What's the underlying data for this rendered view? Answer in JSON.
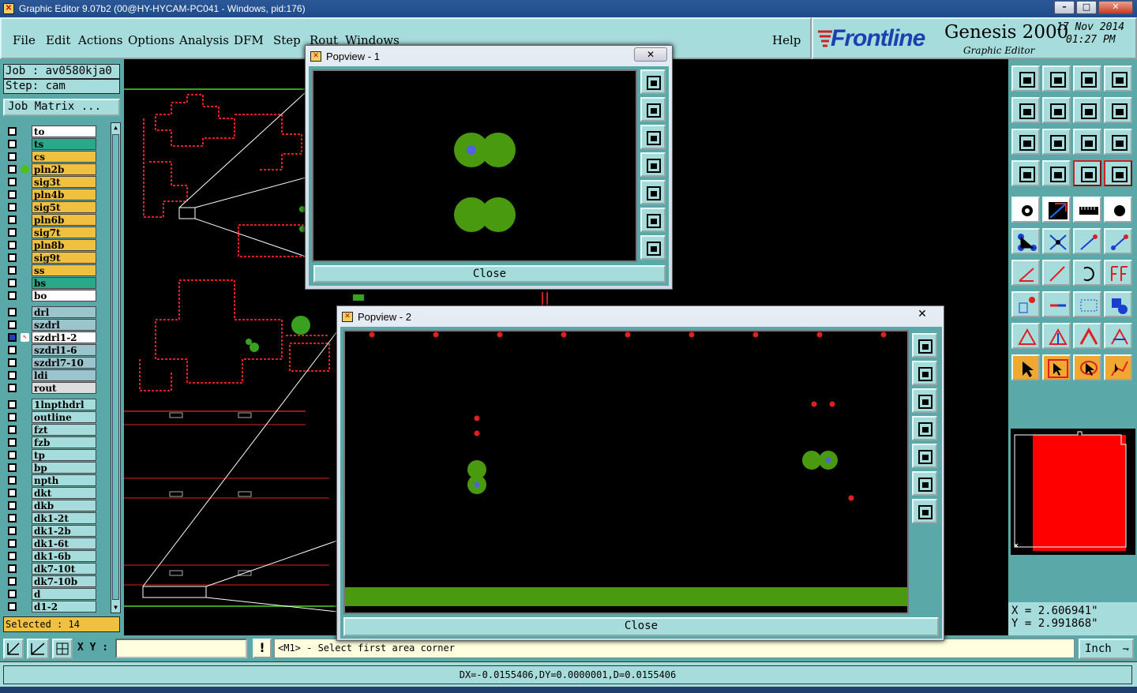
{
  "window": {
    "title": "Graphic Editor 9.07b2 (00@HY-HYCAM-PC041 - Windows, pid:176)"
  },
  "menu": {
    "items": [
      "File",
      "Edit",
      "Actions",
      "Options",
      "Analysis",
      "DFM",
      "Step",
      "Rout",
      "Windows"
    ],
    "help": "Help"
  },
  "brand": {
    "logo": "Frontline",
    "product": "Genesis 2000",
    "subtitle": "Graphic Editor",
    "date": "17 Nov 2014",
    "time": "01:27 PM"
  },
  "job": {
    "job_label": "Job : av0580kja0",
    "step_label": "Step: cam",
    "matrix_button": "Job Matrix ..."
  },
  "layers": {
    "board": [
      {
        "name": "to",
        "color": "#ffffff"
      },
      {
        "name": "ts",
        "color": "#2aa88a"
      },
      {
        "name": "cs",
        "color": "#f0c040"
      },
      {
        "name": "pln2b",
        "color": "#f0c040",
        "marker": "#4cc020"
      },
      {
        "name": "sig3t",
        "color": "#f0c040"
      },
      {
        "name": "pln4b",
        "color": "#f0c040"
      },
      {
        "name": "sig5t",
        "color": "#f0c040"
      },
      {
        "name": "pln6b",
        "color": "#f0c040"
      },
      {
        "name": "sig7t",
        "color": "#f0c040"
      },
      {
        "name": "pln8b",
        "color": "#f0c040"
      },
      {
        "name": "sig9t",
        "color": "#f0c040"
      },
      {
        "name": "ss",
        "color": "#f0c040"
      },
      {
        "name": "bs",
        "color": "#2aa88a"
      },
      {
        "name": "bo",
        "color": "#ffffff"
      }
    ],
    "drill": [
      {
        "name": "drl",
        "color": "#9cc4cc"
      },
      {
        "name": "szdrl",
        "color": "#9cc4cc"
      },
      {
        "name": "szdrl1-2",
        "color": "#ffffff",
        "active": true
      },
      {
        "name": "szdrl1-6",
        "color": "#9cc4cc"
      },
      {
        "name": "szdrl7-10",
        "color": "#9cc4cc"
      },
      {
        "name": "ldi",
        "color": "#9cc4cc"
      },
      {
        "name": "rout",
        "color": "#dddddd"
      }
    ],
    "misc": [
      {
        "name": "1lnpthdrl"
      },
      {
        "name": "outline"
      },
      {
        "name": "fzt"
      },
      {
        "name": "fzb"
      },
      {
        "name": "tp"
      },
      {
        "name": "bp"
      },
      {
        "name": "npth"
      },
      {
        "name": "dkt"
      },
      {
        "name": "dkb"
      },
      {
        "name": "dk1-2t"
      },
      {
        "name": "dk1-2b"
      },
      {
        "name": "dk1-6t"
      },
      {
        "name": "dk1-6b"
      },
      {
        "name": "dk7-10t"
      },
      {
        "name": "dk7-10b"
      },
      {
        "name": "d"
      },
      {
        "name": "d1-2"
      }
    ],
    "selected_label": "Selected : 14"
  },
  "popup1": {
    "title": "Popview - 1",
    "close_label": "Close"
  },
  "popup2": {
    "title": "Popview - 2",
    "close_label": "Close"
  },
  "coords": {
    "x": "X = 2.606941\"",
    "y": "Y = 2.991868\""
  },
  "bottom": {
    "xy_label": "X Y :",
    "xy_value": "",
    "prompt": "<M1> - Select first area corner",
    "units": "Inch"
  },
  "status": {
    "text": "DX=-0.0155406,DY=0.0000001,D=0.0155406"
  },
  "colors": {
    "panel": "#a6dcdc",
    "panel_dark": "#5aa8a8",
    "pad_green": "#4a9a10",
    "feature_red": "#e02020",
    "drill_blue": "#5060e8"
  }
}
